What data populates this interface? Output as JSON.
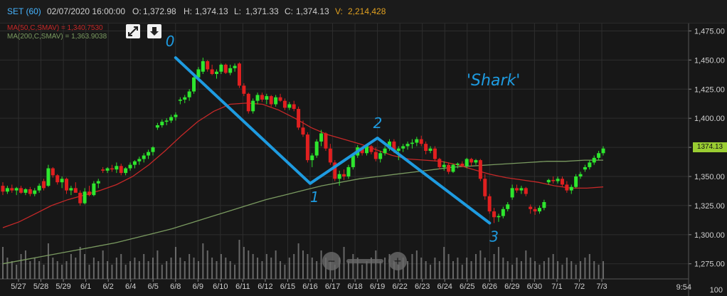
{
  "header": {
    "symbol": "SET (60)",
    "datetime": "02/07/2020 16:00:00",
    "open_label": "O:",
    "open": "1,372.98",
    "high_label": "H:",
    "high": "1,374.13",
    "low_label": "L:",
    "low": "1,371.33",
    "close_label": "C:",
    "close": "1,374.13",
    "volume_label": "V:",
    "volume": "2,214,428"
  },
  "indicators": {
    "ma50": "MA(50,C,SMAV) = 1,340.7530",
    "ma200": "MA(200,C,SMAV) = 1,363.9038"
  },
  "controls": {
    "expand_icon": "expand-icon",
    "download_icon": "download-icon"
  },
  "colors": {
    "background": "#171717",
    "up": "#2ee62e",
    "down": "#e02020",
    "ma50": "#c62828",
    "ma200": "#7a9a60",
    "annotation": "#1e9be0",
    "last_price_tag": "#9acd32",
    "volume": "#8a8a8a"
  },
  "last_price_tag": "1374.13",
  "time_display": "9:54",
  "volume_axis_label": "100",
  "chart_data": {
    "type": "candlestick",
    "title": "SET (60)",
    "x_ticks": [
      "5/27",
      "5/28",
      "5/29",
      "6/1",
      "6/2",
      "6/4",
      "6/5",
      "6/8",
      "6/9",
      "6/10",
      "6/11",
      "6/12",
      "6/15",
      "6/16",
      "6/17",
      "6/18",
      "6/19",
      "6/22",
      "6/23",
      "6/24",
      "6/25",
      "6/26",
      "6/29",
      "6/30",
      "7/1",
      "7/2",
      "7/3"
    ],
    "y_ticks": [
      1275,
      1300,
      1325,
      1350,
      1375,
      1400,
      1425,
      1450,
      1475
    ],
    "y_tick_labels": [
      "1,275.00",
      "1,300.00",
      "1,325.00",
      "1,350.00",
      "1,375.00",
      "1,400.00",
      "1,425.00",
      "1,450.00",
      "1,475.00"
    ],
    "ylim": [
      1262,
      1482
    ],
    "grid": true,
    "candles": [
      [
        1342,
        1345,
        1334,
        1337
      ],
      [
        1337,
        1342,
        1335,
        1340
      ],
      [
        1340,
        1343,
        1336,
        1338
      ],
      [
        1338,
        1341,
        1334,
        1340
      ],
      [
        1340,
        1342,
        1335,
        1336
      ],
      [
        1336,
        1340,
        1334,
        1339
      ],
      [
        1339,
        1341,
        1333,
        1335
      ],
      [
        1335,
        1340,
        1333,
        1338
      ],
      [
        1338,
        1344,
        1336,
        1342
      ],
      [
        1346,
        1348,
        1338,
        1340
      ],
      [
        1342,
        1360,
        1341,
        1357
      ],
      [
        1357,
        1358,
        1349,
        1351
      ],
      [
        1351,
        1352,
        1343,
        1345
      ],
      [
        1345,
        1350,
        1340,
        1348
      ],
      [
        1348,
        1349,
        1335,
        1338
      ],
      [
        1338,
        1342,
        1334,
        1340
      ],
      [
        1340,
        1345,
        1338,
        1336
      ],
      [
        1336,
        1338,
        1325,
        1327
      ],
      [
        1327,
        1340,
        1326,
        1337
      ],
      [
        1337,
        1342,
        1333,
        1334
      ],
      [
        1334,
        1346,
        1333,
        1344
      ],
      [
        1344,
        1348,
        1340,
        1346
      ],
      [
        1356,
        1358,
        1353,
        1355
      ],
      [
        1355,
        1358,
        1353,
        1357
      ],
      [
        1357,
        1360,
        1354,
        1356
      ],
      [
        1356,
        1362,
        1353,
        1359
      ],
      [
        1359,
        1361,
        1351,
        1353
      ],
      [
        1353,
        1358,
        1351,
        1357
      ],
      [
        1357,
        1362,
        1355,
        1360
      ],
      [
        1360,
        1364,
        1357,
        1363
      ],
      [
        1363,
        1367,
        1360,
        1365
      ],
      [
        1365,
        1370,
        1362,
        1368
      ],
      [
        1368,
        1373,
        1365,
        1371
      ],
      [
        1371,
        1376,
        1368,
        1375
      ],
      [
        1392,
        1396,
        1390,
        1394
      ],
      [
        1394,
        1399,
        1392,
        1397
      ],
      [
        1397,
        1400,
        1394,
        1398
      ],
      [
        1398,
        1403,
        1396,
        1401
      ],
      [
        1401,
        1405,
        1398,
        1403
      ],
      [
        1415,
        1418,
        1412,
        1416
      ],
      [
        1416,
        1420,
        1413,
        1418
      ],
      [
        1418,
        1425,
        1415,
        1423
      ],
      [
        1423,
        1437,
        1421,
        1435
      ],
      [
        1435,
        1444,
        1433,
        1442
      ],
      [
        1440,
        1452,
        1438,
        1449
      ],
      [
        1449,
        1450,
        1440,
        1442
      ],
      [
        1442,
        1446,
        1437,
        1438
      ],
      [
        1438,
        1442,
        1434,
        1440
      ],
      [
        1440,
        1447,
        1438,
        1446
      ],
      [
        1446,
        1447,
        1438,
        1439
      ],
      [
        1439,
        1446,
        1437,
        1443
      ],
      [
        1443,
        1447,
        1440,
        1445
      ],
      [
        1447,
        1448,
        1426,
        1428
      ],
      [
        1428,
        1430,
        1419,
        1421
      ],
      [
        1421,
        1422,
        1404,
        1406
      ],
      [
        1406,
        1417,
        1404,
        1415
      ],
      [
        1415,
        1422,
        1412,
        1420
      ],
      [
        1420,
        1422,
        1414,
        1416
      ],
      [
        1416,
        1421,
        1412,
        1419
      ],
      [
        1419,
        1420,
        1410,
        1412
      ],
      [
        1412,
        1420,
        1410,
        1418
      ],
      [
        1418,
        1421,
        1414,
        1415
      ],
      [
        1415,
        1417,
        1407,
        1409
      ],
      [
        1409,
        1414,
        1407,
        1412
      ],
      [
        1412,
        1415,
        1406,
        1408
      ],
      [
        1408,
        1410,
        1390,
        1392
      ],
      [
        1392,
        1398,
        1384,
        1386
      ],
      [
        1386,
        1388,
        1362,
        1364
      ],
      [
        1364,
        1370,
        1358,
        1368
      ],
      [
        1368,
        1382,
        1366,
        1380
      ],
      [
        1380,
        1390,
        1376,
        1387
      ],
      [
        1387,
        1388,
        1372,
        1374
      ],
      [
        1374,
        1378,
        1360,
        1362
      ],
      [
        1362,
        1364,
        1346,
        1348
      ],
      [
        1348,
        1355,
        1342,
        1352
      ],
      [
        1352,
        1356,
        1347,
        1350
      ],
      [
        1350,
        1360,
        1348,
        1358
      ],
      [
        1358,
        1370,
        1356,
        1368
      ],
      [
        1368,
        1377,
        1366,
        1375
      ],
      [
        1375,
        1376,
        1368,
        1370
      ],
      [
        1370,
        1377,
        1368,
        1376
      ],
      [
        1376,
        1377,
        1369,
        1371
      ],
      [
        1371,
        1375,
        1363,
        1365
      ],
      [
        1365,
        1372,
        1362,
        1370
      ],
      [
        1370,
        1376,
        1368,
        1374
      ],
      [
        1374,
        1382,
        1372,
        1380
      ],
      [
        1380,
        1382,
        1370,
        1372
      ],
      [
        1372,
        1376,
        1364,
        1374
      ],
      [
        1374,
        1378,
        1371,
        1376
      ],
      [
        1376,
        1380,
        1373,
        1378
      ],
      [
        1378,
        1382,
        1374,
        1379
      ],
      [
        1379,
        1384,
        1376,
        1382
      ],
      [
        1382,
        1385,
        1376,
        1378
      ],
      [
        1378,
        1380,
        1369,
        1372
      ],
      [
        1372,
        1376,
        1370,
        1374
      ],
      [
        1374,
        1376,
        1363,
        1365
      ],
      [
        1365,
        1366,
        1356,
        1358
      ],
      [
        1358,
        1363,
        1355,
        1360
      ],
      [
        1360,
        1362,
        1352,
        1354
      ],
      [
        1354,
        1361,
        1353,
        1360
      ],
      [
        1360,
        1362,
        1357,
        1361
      ],
      [
        1361,
        1363,
        1358,
        1359
      ],
      [
        1359,
        1366,
        1357,
        1365
      ],
      [
        1365,
        1366,
        1359,
        1362
      ],
      [
        1362,
        1365,
        1360,
        1364
      ],
      [
        1364,
        1365,
        1346,
        1348
      ],
      [
        1348,
        1352,
        1330,
        1333
      ],
      [
        1333,
        1335,
        1318,
        1320
      ],
      [
        1320,
        1323,
        1310,
        1315
      ],
      [
        1315,
        1318,
        1311,
        1316
      ],
      [
        1316,
        1324,
        1314,
        1322
      ],
      [
        1322,
        1328,
        1320,
        1326
      ],
      [
        1332,
        1343,
        1330,
        1340
      ],
      [
        1340,
        1343,
        1336,
        1338
      ],
      [
        1338,
        1342,
        1335,
        1340
      ],
      [
        1340,
        1341,
        1333,
        1335
      ],
      [
        1324,
        1326,
        1318,
        1322
      ],
      [
        1322,
        1324,
        1317,
        1320
      ],
      [
        1320,
        1325,
        1318,
        1323
      ],
      [
        1323,
        1330,
        1321,
        1328
      ],
      [
        1345,
        1348,
        1343,
        1347
      ],
      [
        1347,
        1350,
        1344,
        1346
      ],
      [
        1346,
        1350,
        1344,
        1348
      ],
      [
        1348,
        1350,
        1341,
        1343
      ],
      [
        1343,
        1346,
        1336,
        1338
      ],
      [
        1338,
        1343,
        1335,
        1341
      ],
      [
        1341,
        1352,
        1340,
        1350
      ],
      [
        1350,
        1354,
        1348,
        1352
      ],
      [
        1356,
        1360,
        1354,
        1358
      ],
      [
        1358,
        1364,
        1356,
        1362
      ],
      [
        1362,
        1368,
        1360,
        1366
      ],
      [
        1366,
        1372,
        1364,
        1370
      ],
      [
        1370,
        1376,
        1368,
        1374
      ]
    ],
    "series": [
      {
        "name": "MA(50,C,SMAV)",
        "values": [
          1306,
          1311,
          1318,
          1325,
          1330,
          1334,
          1338,
          1343,
          1350,
          1360,
          1372,
          1385,
          1397,
          1406,
          1412,
          1413,
          1412,
          1407,
          1400,
          1392,
          1386,
          1382,
          1378,
          1373,
          1368,
          1365,
          1364,
          1363,
          1360,
          1356,
          1352,
          1349,
          1347,
          1345,
          1342,
          1340,
          1340,
          1341
        ]
      },
      {
        "name": "MA(200,C,SMAV)",
        "values": [
          1275,
          1278,
          1281,
          1284,
          1287,
          1290,
          1293,
          1297,
          1301,
          1305,
          1310,
          1315,
          1320,
          1325,
          1330,
          1334,
          1338,
          1342,
          1345,
          1348,
          1350,
          1352,
          1354,
          1356,
          1358,
          1359,
          1360,
          1361,
          1362,
          1363,
          1363,
          1364,
          1364
        ]
      }
    ],
    "volume": [
      9,
      6,
      5,
      4,
      7,
      8,
      5,
      6,
      5,
      4,
      10,
      6,
      5,
      4,
      5,
      7,
      6,
      9,
      7,
      4,
      6,
      5,
      8,
      5,
      4,
      6,
      7,
      4,
      5,
      6,
      5,
      7,
      5,
      6,
      8,
      4,
      5,
      6,
      9,
      6,
      5,
      7,
      6,
      5,
      10,
      8,
      6,
      5,
      7,
      6,
      5,
      4,
      11,
      9,
      8,
      7,
      6,
      5,
      7,
      6,
      8,
      5,
      4,
      6,
      7,
      10,
      8,
      7,
      6,
      5,
      8,
      6,
      5,
      4,
      6,
      9,
      5,
      7,
      6,
      4,
      5,
      6,
      8,
      5,
      6,
      7,
      5,
      4,
      6,
      5,
      7,
      8,
      6,
      5,
      4,
      6,
      5,
      9,
      7,
      5,
      6,
      4,
      6,
      5,
      7,
      8,
      6,
      5,
      7,
      9,
      6,
      5,
      4,
      6,
      5,
      8,
      6,
      5,
      4,
      5,
      6,
      7,
      5,
      4,
      6,
      5,
      4,
      5,
      6,
      7,
      5,
      4,
      5
    ],
    "annotations": {
      "points": [
        {
          "label": "0",
          "x_tick": "6/8",
          "y": 1452
        },
        {
          "label": "1",
          "x_tick": "6/16",
          "y": 1344
        },
        {
          "label": "2",
          "x_tick": "6/19",
          "y": 1383
        },
        {
          "label": "3",
          "x_tick": "6/26",
          "y": 1310
        }
      ],
      "pattern_label": "'Shark'"
    },
    "last_value": 1374.13
  }
}
